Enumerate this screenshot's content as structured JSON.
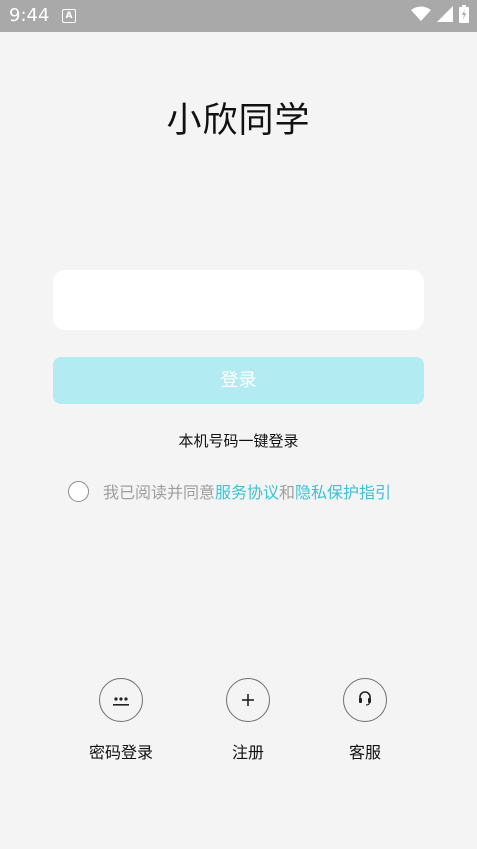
{
  "status_bar": {
    "time": "9:44",
    "notification_badge": "A",
    "icons": [
      "wifi-icon",
      "signal-icon",
      "battery-icon"
    ]
  },
  "app": {
    "title": "小欣同学"
  },
  "login_form": {
    "phone_value": "",
    "login_button": "登录",
    "one_key_login": "本机号码一键登录"
  },
  "agreement": {
    "prefix": "我已阅读并同意",
    "service_link": "服务协议",
    "and": "和",
    "privacy_link": "隐私保护指引"
  },
  "bottom_actions": [
    {
      "label": "密码登录",
      "icon": "password-dots-icon"
    },
    {
      "label": "注册",
      "icon": "plus-icon"
    },
    {
      "label": "客服",
      "icon": "headset-icon"
    }
  ],
  "colors": {
    "accent": "#3ac3d6",
    "login_button_disabled": "#b2ebf2",
    "status_bar": "#a9a9a9",
    "background": "#f4f4f4"
  }
}
